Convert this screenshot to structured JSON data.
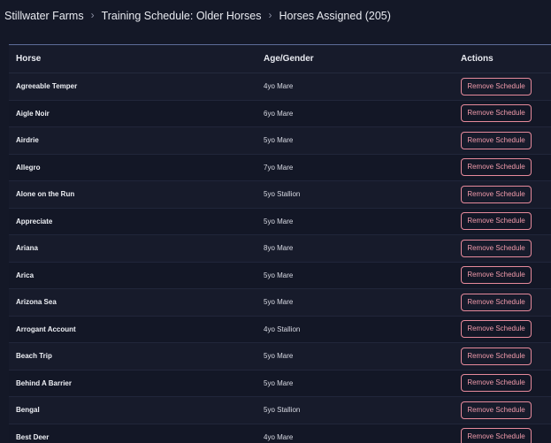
{
  "breadcrumb": {
    "items": [
      "Stillwater Farms",
      "Training Schedule: Older Horses",
      "Horses Assigned (205)"
    ],
    "separator": "›"
  },
  "table": {
    "columns": [
      "Horse",
      "Age/Gender",
      "Actions"
    ],
    "action_label": "Remove Schedule",
    "rows": [
      {
        "horse": "Agreeable Temper",
        "age_gender": "4yo Mare"
      },
      {
        "horse": "Aigle Noir",
        "age_gender": "6yo Mare"
      },
      {
        "horse": "Airdrie",
        "age_gender": "5yo Mare"
      },
      {
        "horse": "Allegro",
        "age_gender": "7yo Mare"
      },
      {
        "horse": "Alone on the Run",
        "age_gender": "5yo Stallion"
      },
      {
        "horse": "Appreciate",
        "age_gender": "5yo Mare"
      },
      {
        "horse": "Ariana",
        "age_gender": "8yo Mare"
      },
      {
        "horse": "Arica",
        "age_gender": "5yo Mare"
      },
      {
        "horse": "Arizona Sea",
        "age_gender": "5yo Mare"
      },
      {
        "horse": "Arrogant Account",
        "age_gender": "4yo Stallion"
      },
      {
        "horse": "Beach Trip",
        "age_gender": "5yo Mare"
      },
      {
        "horse": "Behind A Barrier",
        "age_gender": "5yo Mare"
      },
      {
        "horse": "Bengal",
        "age_gender": "5yo Stallion"
      },
      {
        "horse": "Best Deer",
        "age_gender": "4yo Mare"
      }
    ]
  },
  "colors": {
    "background": "#141827",
    "divider": "#5d6c98",
    "remove_button": "#f09aaa"
  }
}
